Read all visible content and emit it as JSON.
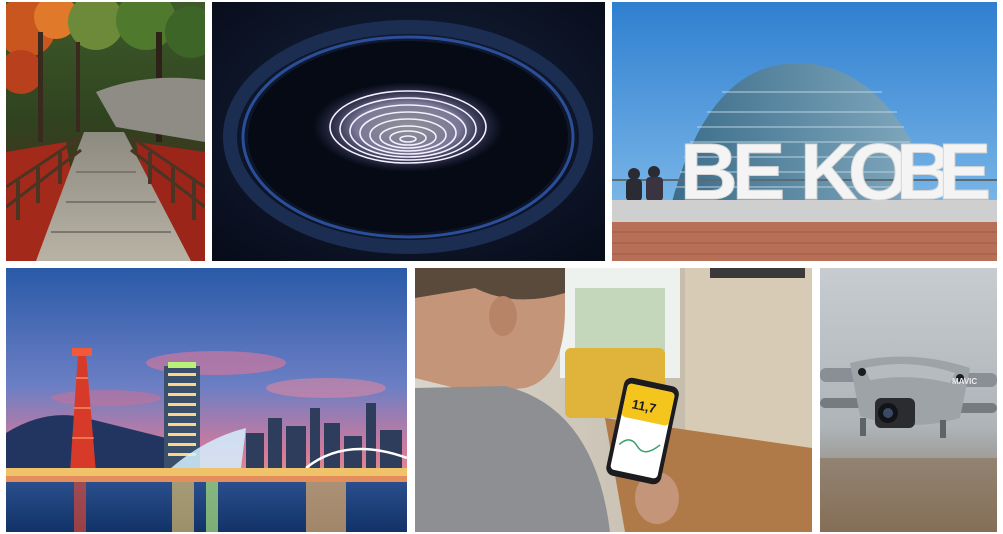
{
  "tiles": {
    "kobe_sign": {
      "letters": [
        "B",
        "E",
        "K",
        "O",
        "B",
        "E"
      ]
    },
    "phone": {
      "reading": "11,7"
    },
    "drone": {
      "brand": "MAVIC"
    }
  },
  "colors": {
    "autumn_red": "#b8321f",
    "fingerprint_glow": "#e9e4ff",
    "sky_blue": "#3f8fd6",
    "sunset_pink": "#d57a9a",
    "phone_yellow": "#f4c51d",
    "drone_grey": "#8a8f95"
  }
}
